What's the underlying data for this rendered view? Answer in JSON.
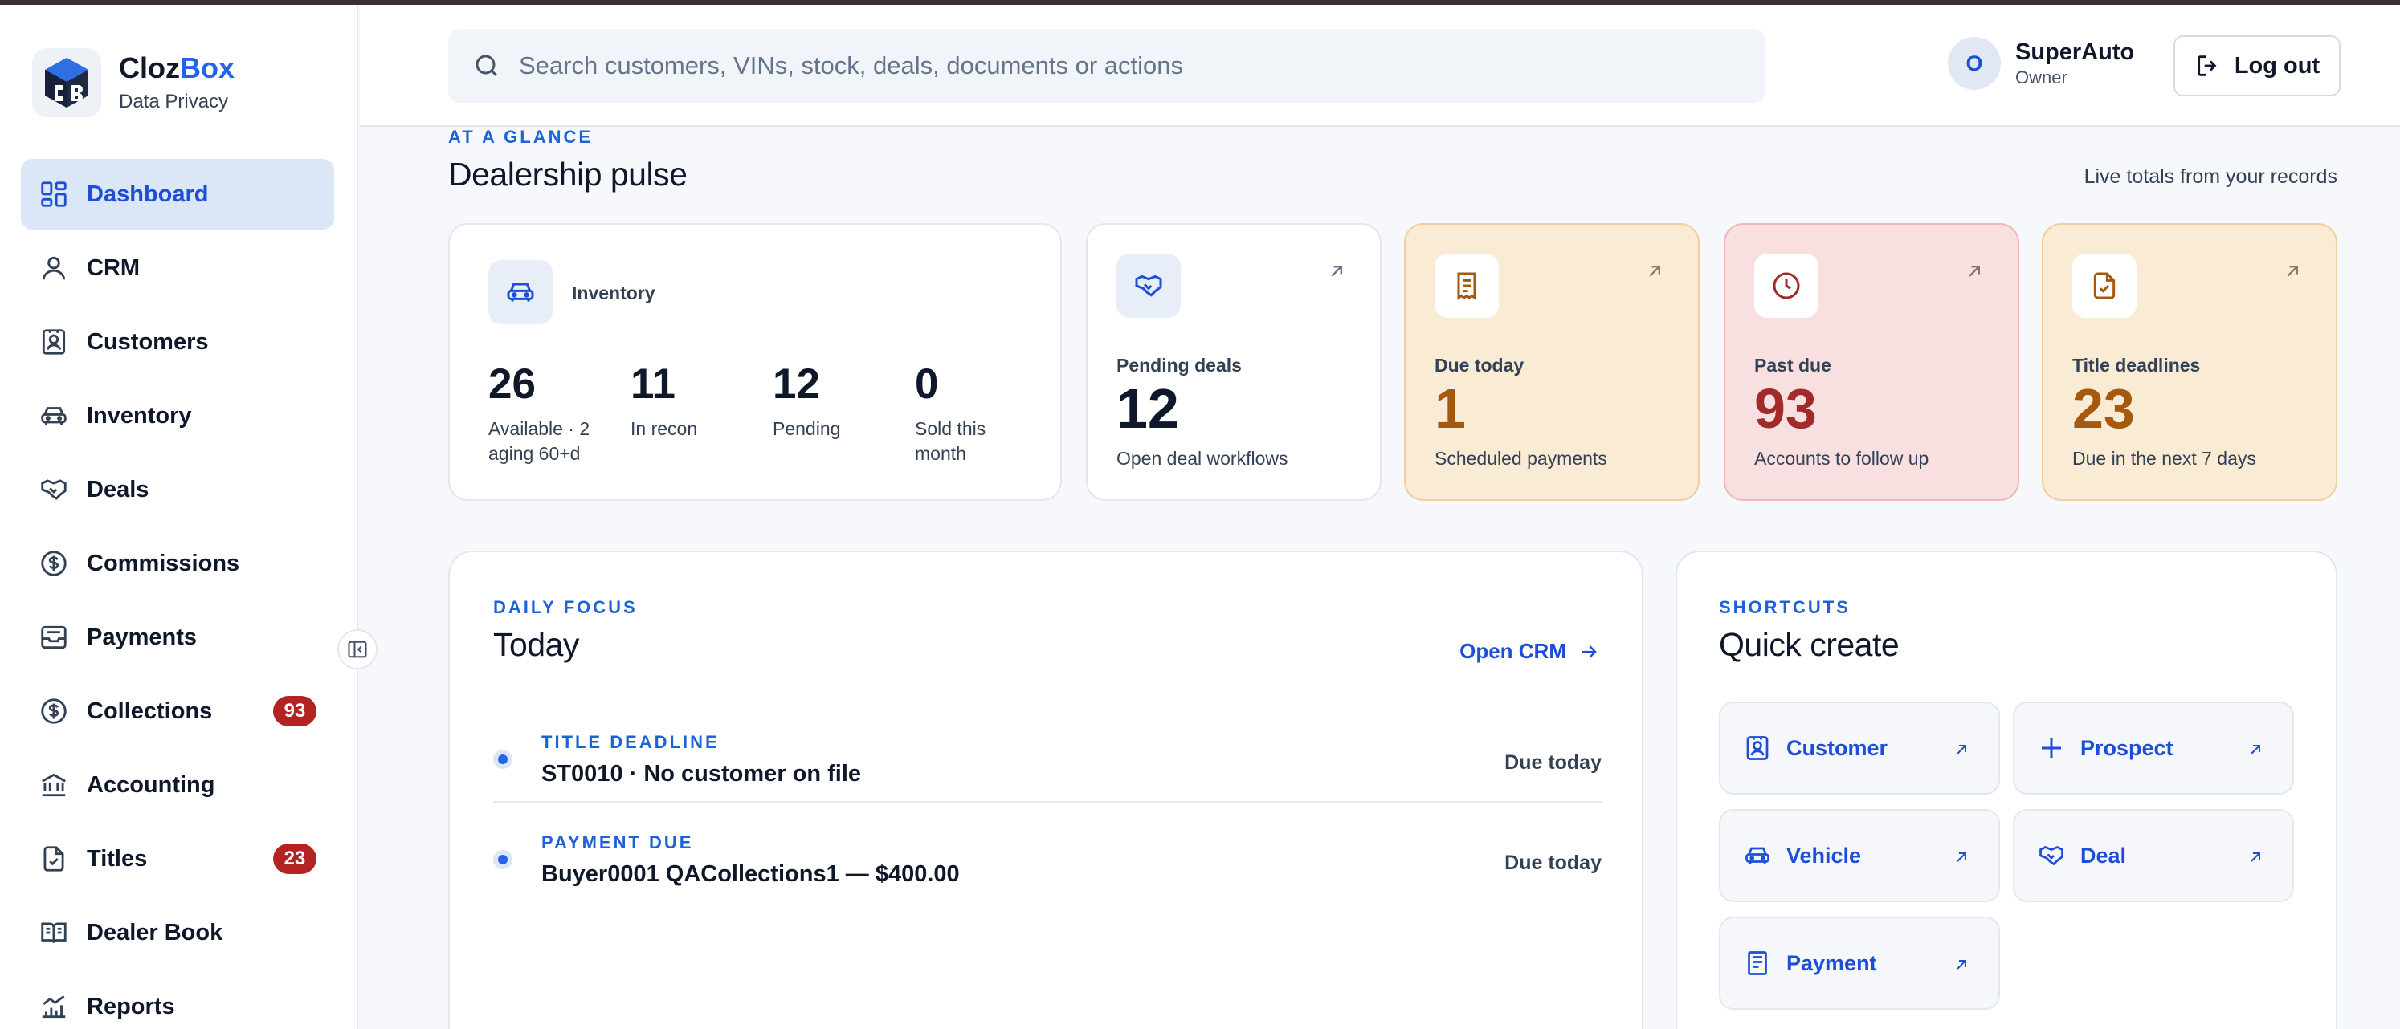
{
  "brand": {
    "name_part1": "Cloz",
    "name_part2": "Box",
    "subtitle": "Data Privacy"
  },
  "sidebar": {
    "items": [
      {
        "label": "Dashboard",
        "icon": "dashboard-icon",
        "active": true
      },
      {
        "label": "CRM",
        "icon": "user-icon"
      },
      {
        "label": "Customers",
        "icon": "contact-card-icon"
      },
      {
        "label": "Inventory",
        "icon": "car-icon"
      },
      {
        "label": "Deals",
        "icon": "handshake-icon"
      },
      {
        "label": "Commissions",
        "icon": "dollar-circle-icon"
      },
      {
        "label": "Payments",
        "icon": "inbox-icon"
      },
      {
        "label": "Collections",
        "icon": "dollar-circle-icon",
        "badge": "93"
      },
      {
        "label": "Accounting",
        "icon": "bank-icon"
      },
      {
        "label": "Titles",
        "icon": "file-check-icon",
        "badge": "23"
      },
      {
        "label": "Dealer Book",
        "icon": "book-icon"
      },
      {
        "label": "Reports",
        "icon": "bar-chart-icon"
      }
    ]
  },
  "header": {
    "search_placeholder": "Search customers, VINs, stock, deals, documents or actions",
    "user_initial": "O",
    "user_name": "SuperAuto",
    "user_role": "Owner",
    "logout_label": "Log out"
  },
  "pulse": {
    "eyebrow": "AT A GLANCE",
    "title": "Dealership pulse",
    "note": "Live totals from your records",
    "inventory": {
      "label": "Inventory",
      "stats": [
        {
          "value": "26",
          "label": "Available · 2 aging 60+d"
        },
        {
          "value": "11",
          "label": "In recon"
        },
        {
          "value": "12",
          "label": "Pending"
        },
        {
          "value": "0",
          "label": "Sold this month"
        }
      ]
    },
    "pending": {
      "label": "Pending deals",
      "value": "12",
      "sub": "Open deal workflows",
      "color": "#0f172a"
    },
    "due_today": {
      "label": "Due today",
      "value": "1",
      "sub": "Scheduled payments",
      "color": "#a4590f"
    },
    "past_due": {
      "label": "Past due",
      "value": "93",
      "sub": "Accounts to follow up",
      "color": "#a12a2a"
    },
    "title_deadlines": {
      "label": "Title deadlines",
      "value": "23",
      "sub": "Due in the next 7 days",
      "color": "#a4590f"
    }
  },
  "today": {
    "eyebrow": "DAILY FOCUS",
    "title": "Today",
    "open_crm_label": "Open CRM",
    "tasks": [
      {
        "kind": "TITLE DEADLINE",
        "title": "ST0010 · No customer on file",
        "due": "Due today"
      },
      {
        "kind": "PAYMENT DUE",
        "title": "Buyer0001 QACollections1 — $400.00",
        "due": "Due today"
      }
    ]
  },
  "quick_create": {
    "eyebrow": "SHORTCUTS",
    "title": "Quick create",
    "items": [
      {
        "label": "Customer",
        "icon": "contact-card-icon"
      },
      {
        "label": "Prospect",
        "icon": "plus-icon"
      },
      {
        "label": "Vehicle",
        "icon": "car-icon"
      },
      {
        "label": "Deal",
        "icon": "handshake-icon"
      },
      {
        "label": "Payment",
        "icon": "receipt-icon"
      }
    ]
  },
  "colors": {
    "accent": "#1d4ed8",
    "badge": "#b42323",
    "warm_card": "#faebd4",
    "red_card": "#f8e0e0"
  }
}
